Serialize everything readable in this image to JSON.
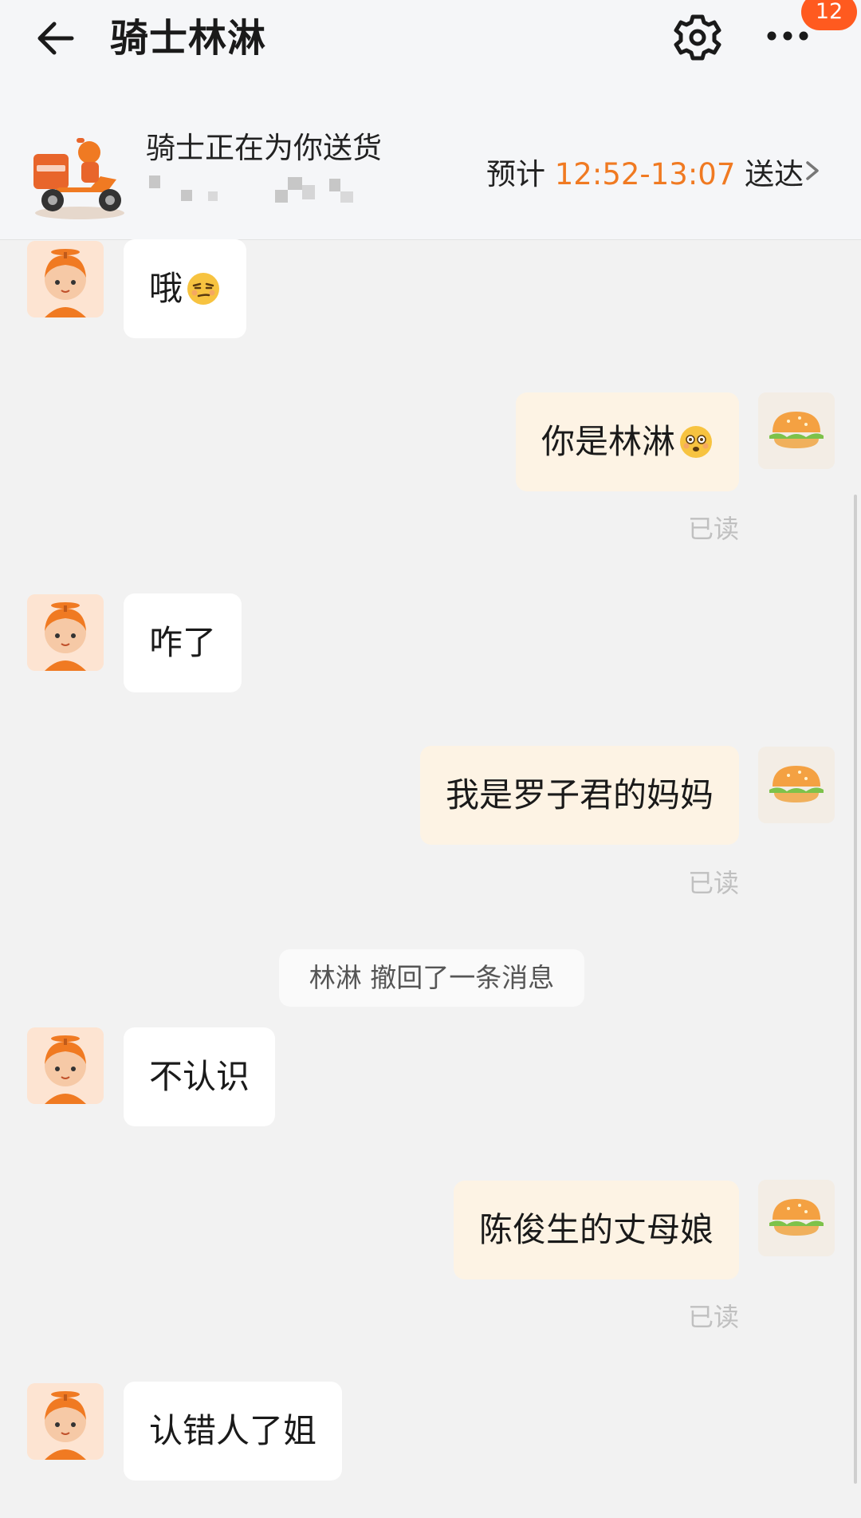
{
  "header": {
    "title": "骑士林淋",
    "badge_count": "12"
  },
  "status_card": {
    "status_text": "骑士正在为你送货",
    "eta_prefix": "预计",
    "eta_time": "12:52-13:07",
    "eta_suffix": "送达"
  },
  "messages": [
    {
      "side": "left",
      "text": "哦",
      "emoji": "smirk-emoji"
    },
    {
      "side": "right",
      "text": "你是林淋",
      "emoji": "flushed-emoji",
      "read": "已读"
    },
    {
      "side": "left",
      "text": "咋了"
    },
    {
      "side": "right",
      "text": "我是罗子君的妈妈",
      "read": "已读"
    },
    {
      "side": "right",
      "text": "陈俊生的丈母娘",
      "read": "已读"
    },
    {
      "side": "left",
      "text": "不认识"
    },
    {
      "side": "left",
      "text": "认错人了姐"
    }
  ],
  "system_notice": "林淋 撤回了一条消息",
  "colors": {
    "accent_orange": "#f07a22",
    "badge": "#ff5a1f",
    "my_bubble": "#fdf3e4",
    "their_bubble": "#ffffff"
  }
}
